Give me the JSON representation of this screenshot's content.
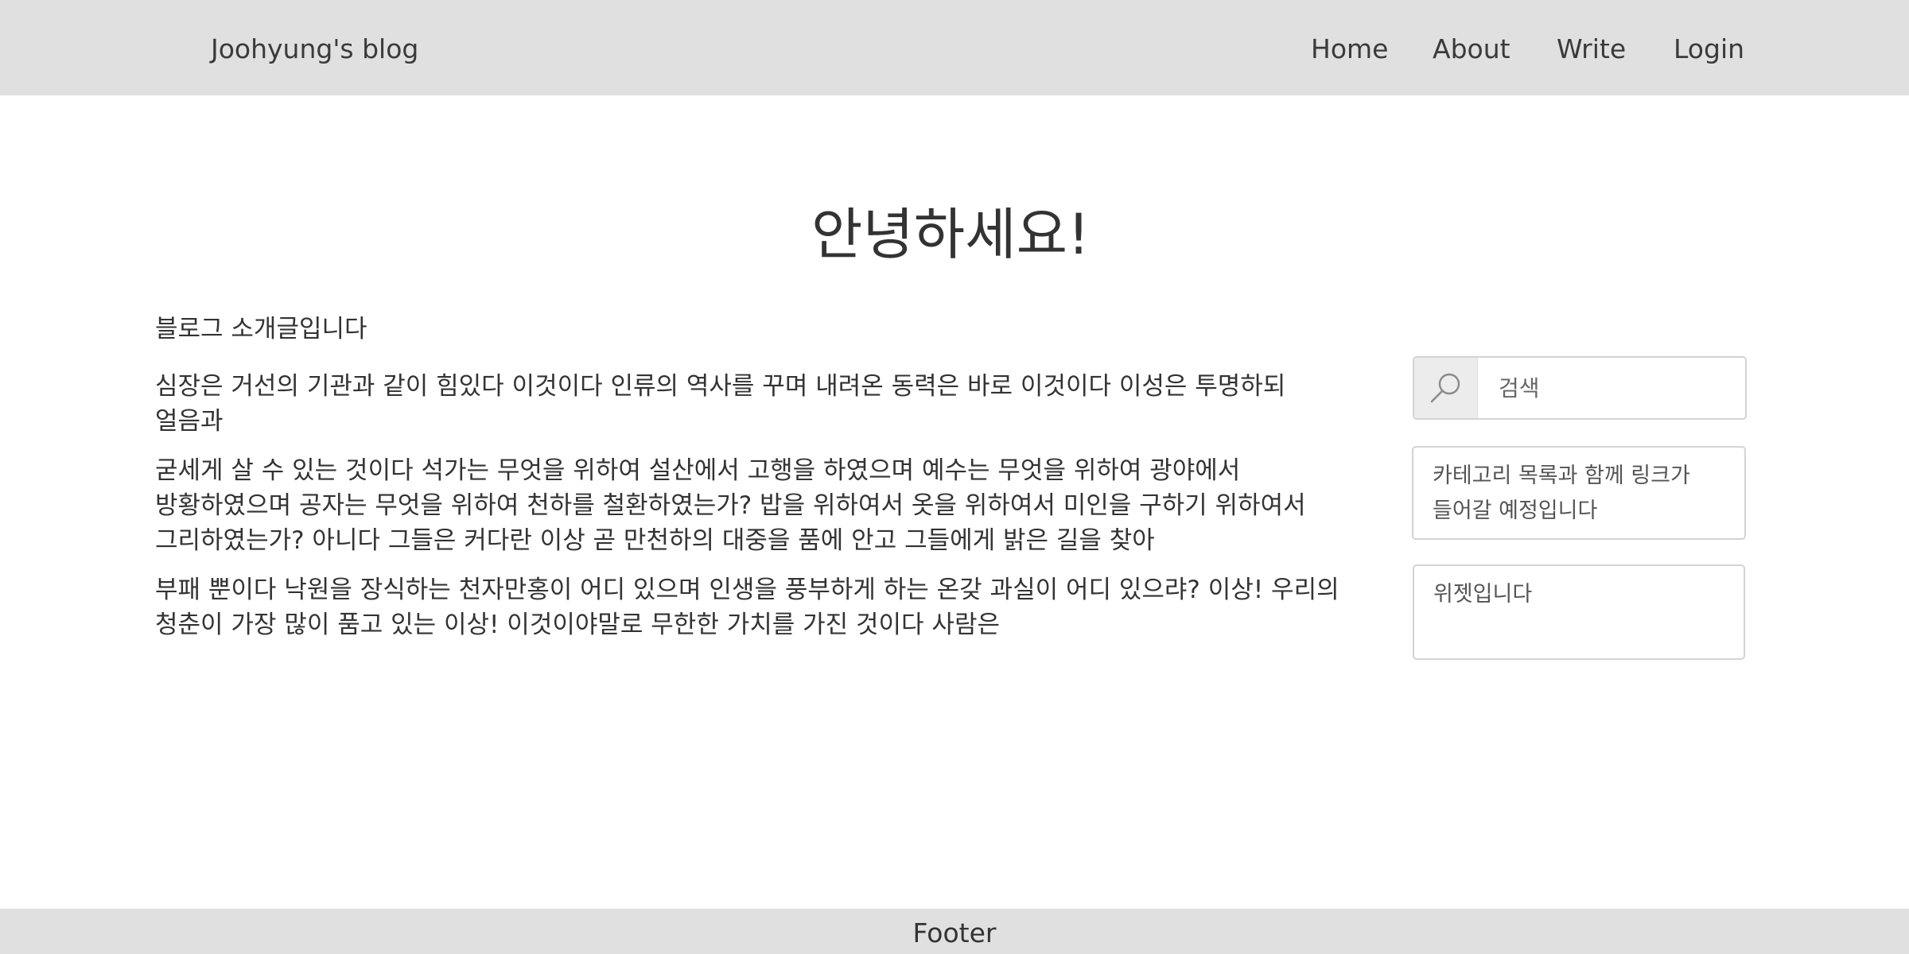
{
  "header": {
    "brand": "Joohyung's blog",
    "nav": [
      "Home",
      "About",
      "Write",
      "Login"
    ]
  },
  "main": {
    "title": "안녕하세요!",
    "intro": "블로그 소개글입니다",
    "paragraphs": [
      "심장은 거선의 기관과 같이 힘있다 이것이다 인류의 역사를 꾸며 내려온 동력은 바로 이것이다 이성은 투명하되 얼음과",
      "굳세게 살 수 있는 것이다 석가는 무엇을 위하여 설산에서 고행을 하였으며 예수는 무엇을 위하여 광야에서 방황하였으며 공자는 무엇을 위하여 천하를 철환하였는가? 밥을 위하여서 옷을 위하여서 미인을 구하기 위하여서 그리하였는가? 아니다 그들은 커다란 이상 곧 만천하의 대중을 품에 안고 그들에게 밝은 길을 찾아",
      "부패 뿐이다 낙원을 장식하는 천자만홍이 어디 있으며 인생을 풍부하게 하는 온갖 과실이 어디 있으랴? 이상! 우리의 청춘이 가장 많이 품고 있는 이상! 이것이야말로 무한한 가치를 가진 것이다 사람은"
    ]
  },
  "sidebar": {
    "search": {
      "icon": "search-icon",
      "placeholder": "검색"
    },
    "widgets": [
      "카테고리 목록과 함께 링크가 들어갈 예정입니다",
      "위젯입니다"
    ]
  },
  "footer": {
    "text": "Footer"
  },
  "colors": {
    "bar_background": "#e0e0e0",
    "text": "#333333",
    "widget_border": "#d3d3d3"
  }
}
